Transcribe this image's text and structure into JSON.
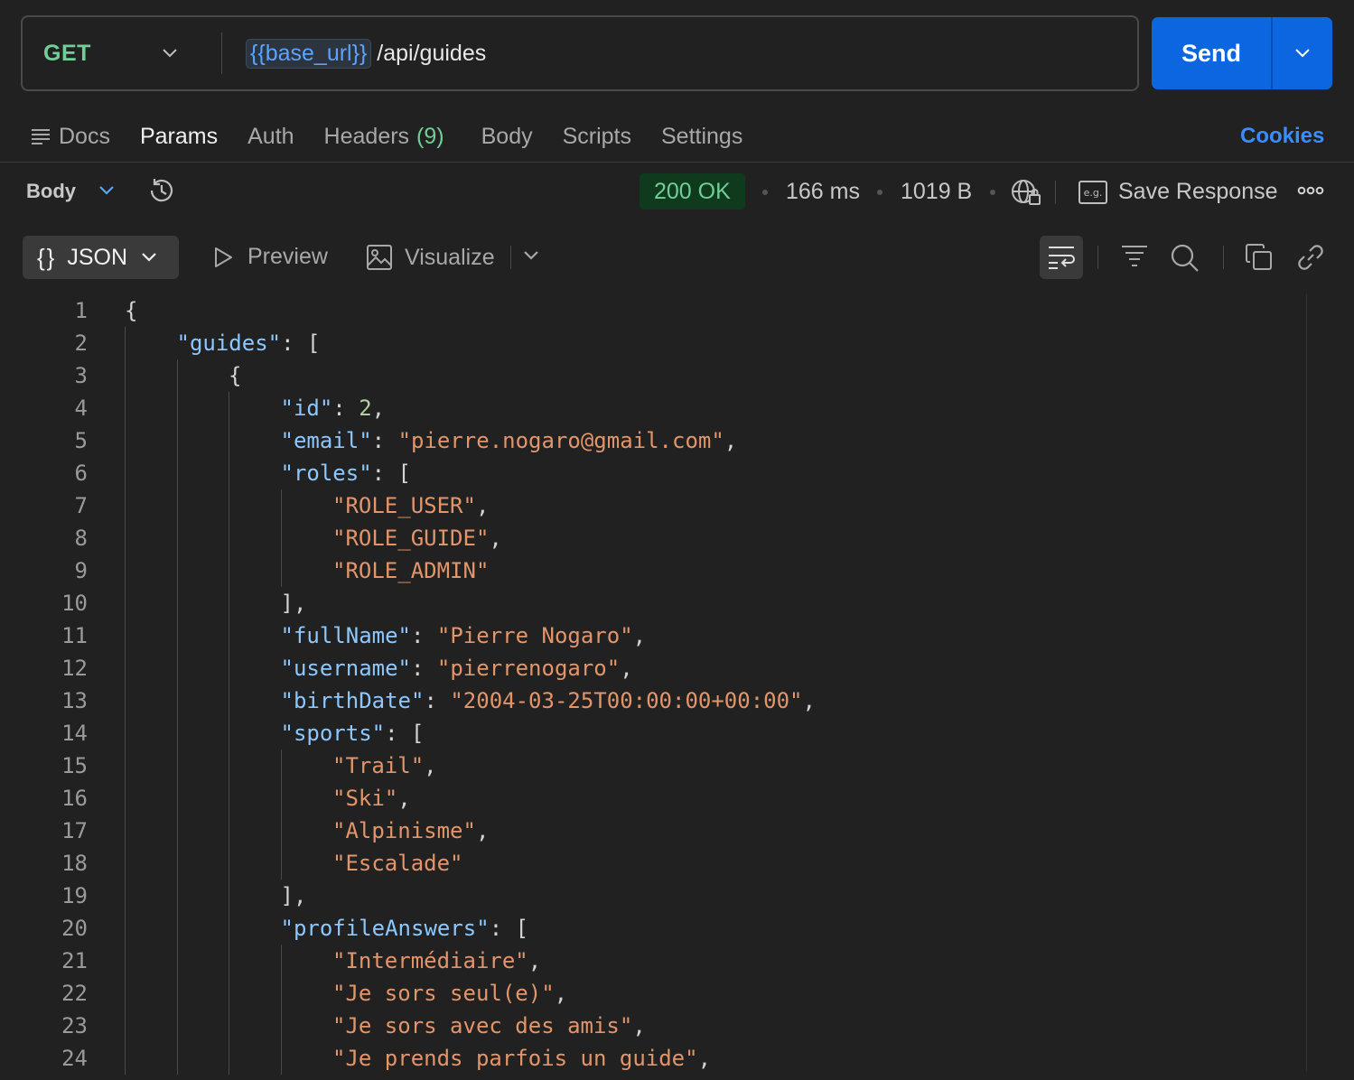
{
  "request": {
    "method": "GET",
    "url_variable": "{{base_url}}",
    "url_path": "/api/guides",
    "send_label": "Send"
  },
  "tabs": [
    {
      "label": "Docs"
    },
    {
      "label": "Params"
    },
    {
      "label": "Auth"
    },
    {
      "label": "Headers",
      "count": "(9)"
    },
    {
      "label": "Body"
    },
    {
      "label": "Scripts"
    },
    {
      "label": "Settings"
    }
  ],
  "cookies_label": "Cookies",
  "response": {
    "body_label": "Body",
    "status": "200 OK",
    "time": "166 ms",
    "size": "1019 B",
    "save_label": "Save Response",
    "format_label": "JSON",
    "preview_label": "Preview",
    "visualize_label": "Visualize"
  },
  "colors": {
    "accent": "#0b66e0",
    "method": "#6fcf97",
    "key": "#8cc8ff",
    "string": "#e3956a",
    "number": "#b5cea8"
  },
  "code_lines": [
    {
      "n": "1",
      "indent": 0,
      "parts": [
        {
          "t": "p",
          "v": "{"
        }
      ]
    },
    {
      "n": "2",
      "indent": 1,
      "parts": [
        {
          "t": "k",
          "v": "\"guides\""
        },
        {
          "t": "p",
          "v": ": ["
        }
      ]
    },
    {
      "n": "3",
      "indent": 2,
      "parts": [
        {
          "t": "p",
          "v": "{"
        }
      ]
    },
    {
      "n": "4",
      "indent": 3,
      "parts": [
        {
          "t": "k",
          "v": "\"id\""
        },
        {
          "t": "p",
          "v": ": "
        },
        {
          "t": "n",
          "v": "2"
        },
        {
          "t": "p",
          "v": ","
        }
      ]
    },
    {
      "n": "5",
      "indent": 3,
      "parts": [
        {
          "t": "k",
          "v": "\"email\""
        },
        {
          "t": "p",
          "v": ": "
        },
        {
          "t": "s",
          "v": "\"pierre.nogaro@gmail.com\""
        },
        {
          "t": "p",
          "v": ","
        }
      ]
    },
    {
      "n": "6",
      "indent": 3,
      "parts": [
        {
          "t": "k",
          "v": "\"roles\""
        },
        {
          "t": "p",
          "v": ": ["
        }
      ]
    },
    {
      "n": "7",
      "indent": 4,
      "parts": [
        {
          "t": "s",
          "v": "\"ROLE_USER\""
        },
        {
          "t": "p",
          "v": ","
        }
      ]
    },
    {
      "n": "8",
      "indent": 4,
      "parts": [
        {
          "t": "s",
          "v": "\"ROLE_GUIDE\""
        },
        {
          "t": "p",
          "v": ","
        }
      ]
    },
    {
      "n": "9",
      "indent": 4,
      "parts": [
        {
          "t": "s",
          "v": "\"ROLE_ADMIN\""
        }
      ]
    },
    {
      "n": "10",
      "indent": 3,
      "parts": [
        {
          "t": "p",
          "v": "],"
        }
      ]
    },
    {
      "n": "11",
      "indent": 3,
      "parts": [
        {
          "t": "k",
          "v": "\"fullName\""
        },
        {
          "t": "p",
          "v": ": "
        },
        {
          "t": "s",
          "v": "\"Pierre Nogaro\""
        },
        {
          "t": "p",
          "v": ","
        }
      ]
    },
    {
      "n": "12",
      "indent": 3,
      "parts": [
        {
          "t": "k",
          "v": "\"username\""
        },
        {
          "t": "p",
          "v": ": "
        },
        {
          "t": "s",
          "v": "\"pierrenogaro\""
        },
        {
          "t": "p",
          "v": ","
        }
      ]
    },
    {
      "n": "13",
      "indent": 3,
      "parts": [
        {
          "t": "k",
          "v": "\"birthDate\""
        },
        {
          "t": "p",
          "v": ": "
        },
        {
          "t": "s",
          "v": "\"2004-03-25T00:00:00+00:00\""
        },
        {
          "t": "p",
          "v": ","
        }
      ]
    },
    {
      "n": "14",
      "indent": 3,
      "parts": [
        {
          "t": "k",
          "v": "\"sports\""
        },
        {
          "t": "p",
          "v": ": ["
        }
      ]
    },
    {
      "n": "15",
      "indent": 4,
      "parts": [
        {
          "t": "s",
          "v": "\"Trail\""
        },
        {
          "t": "p",
          "v": ","
        }
      ]
    },
    {
      "n": "16",
      "indent": 4,
      "parts": [
        {
          "t": "s",
          "v": "\"Ski\""
        },
        {
          "t": "p",
          "v": ","
        }
      ]
    },
    {
      "n": "17",
      "indent": 4,
      "parts": [
        {
          "t": "s",
          "v": "\"Alpinisme\""
        },
        {
          "t": "p",
          "v": ","
        }
      ]
    },
    {
      "n": "18",
      "indent": 4,
      "parts": [
        {
          "t": "s",
          "v": "\"Escalade\""
        }
      ]
    },
    {
      "n": "19",
      "indent": 3,
      "parts": [
        {
          "t": "p",
          "v": "],"
        }
      ]
    },
    {
      "n": "20",
      "indent": 3,
      "parts": [
        {
          "t": "k",
          "v": "\"profileAnswers\""
        },
        {
          "t": "p",
          "v": ": ["
        }
      ]
    },
    {
      "n": "21",
      "indent": 4,
      "parts": [
        {
          "t": "s",
          "v": "\"Intermédiaire\""
        },
        {
          "t": "p",
          "v": ","
        }
      ]
    },
    {
      "n": "22",
      "indent": 4,
      "parts": [
        {
          "t": "s",
          "v": "\"Je sors seul(e)\""
        },
        {
          "t": "p",
          "v": ","
        }
      ]
    },
    {
      "n": "23",
      "indent": 4,
      "parts": [
        {
          "t": "s",
          "v": "\"Je sors avec des amis\""
        },
        {
          "t": "p",
          "v": ","
        }
      ]
    },
    {
      "n": "24",
      "indent": 4,
      "parts": [
        {
          "t": "s",
          "v": "\"Je prends parfois un guide\""
        },
        {
          "t": "p",
          "v": ","
        }
      ]
    }
  ]
}
